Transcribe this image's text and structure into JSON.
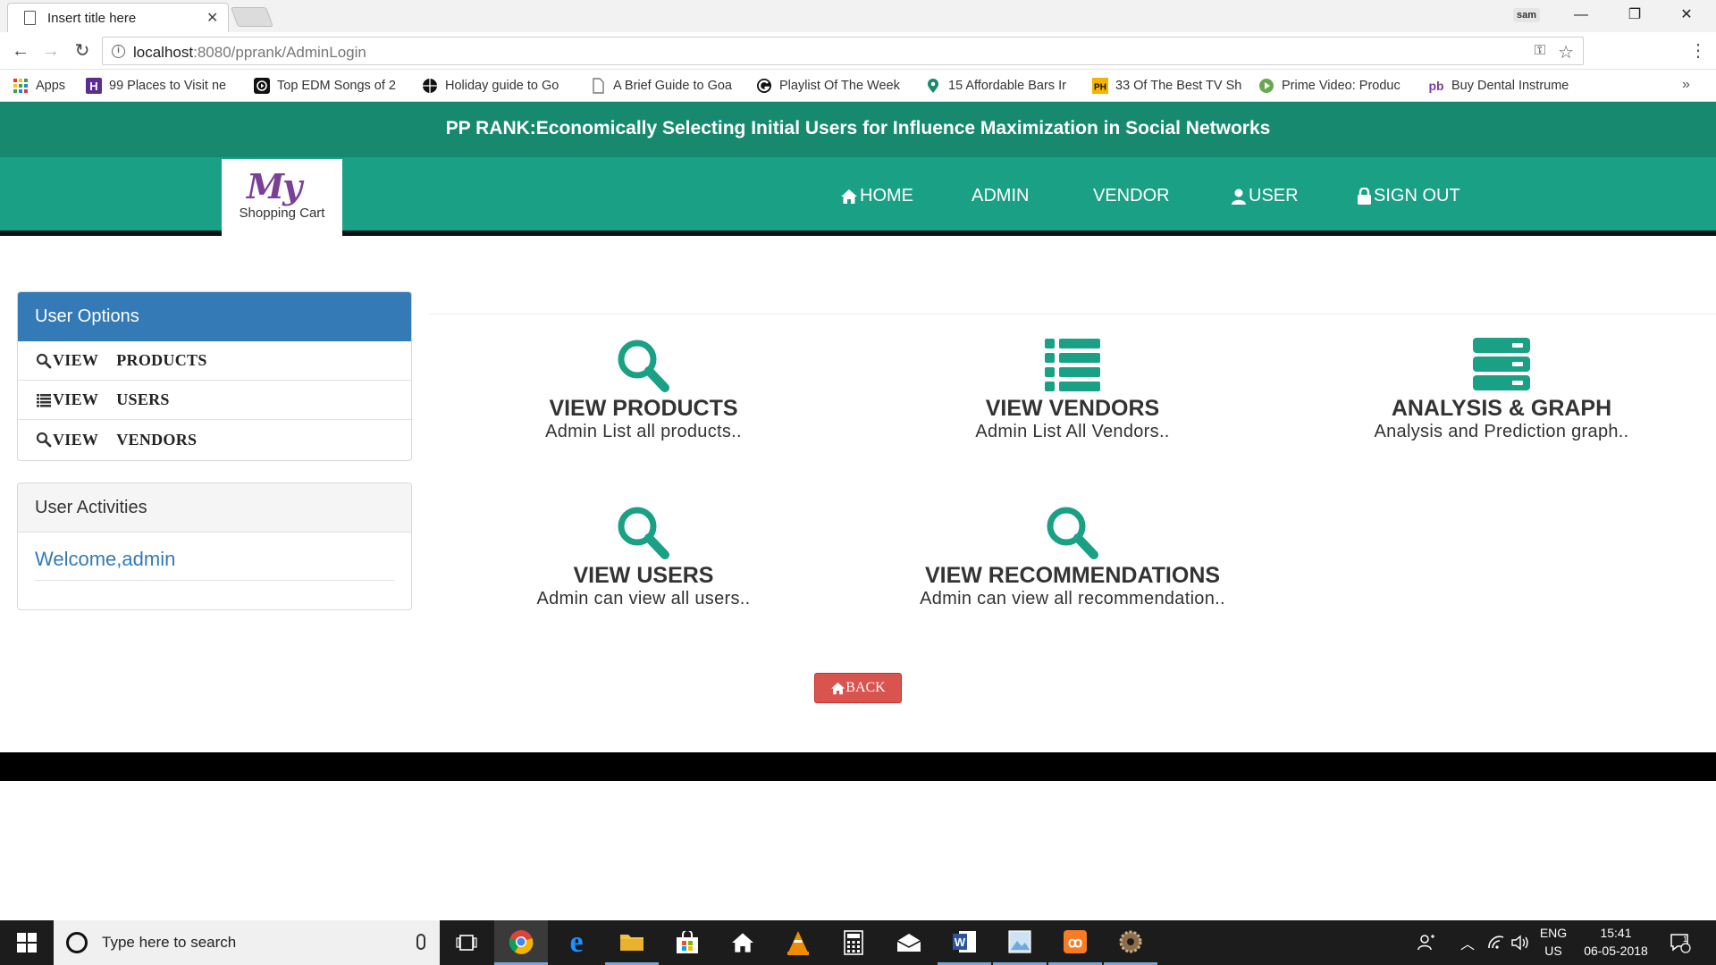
{
  "browser": {
    "tab_title": "Insert title here",
    "profile_name": "sam",
    "url_host": "localhost",
    "url_rest": ":8080/pprank/AdminLogin",
    "bookmarks": [
      {
        "label": "Apps",
        "icon": "apps-grid-icon",
        "color": "#e53935"
      },
      {
        "label": "99 Places to Visit ne",
        "icon": "h-bookmark-icon",
        "color": "#5c2d91"
      },
      {
        "label": "Top EDM Songs of 2",
        "icon": "play-circle-icon",
        "color": "#111111"
      },
      {
        "label": "Holiday guide to Go",
        "icon": "globe-icon",
        "color": "#111111"
      },
      {
        "label": "A Brief Guide to Goa",
        "icon": "page-icon",
        "color": "#777777"
      },
      {
        "label": "Playlist Of The Week",
        "icon": "g-logo-icon",
        "color": "#111111"
      },
      {
        "label": "15 Affordable Bars Ir",
        "icon": "map-pin-icon",
        "color": "#17896f"
      },
      {
        "label": "33 Of The Best TV Sh",
        "icon": "ph-icon",
        "color": "#f4b400"
      },
      {
        "label": "Prime Video: Produc",
        "icon": "prime-play-icon",
        "color": "#6aa84f"
      },
      {
        "label": "Buy Dental Instrume",
        "icon": "pb-icon",
        "color": "#7b3f98"
      }
    ]
  },
  "site": {
    "title": "PP RANK:Economically Selecting Initial Users for Influence Maximization in Social Networks",
    "logo_script": "My",
    "logo_text": "Shopping Cart",
    "nav": {
      "home": "HOME",
      "admin": "ADMIN",
      "vendor": "VENDOR",
      "user": "USER",
      "signout": "SIGN OUT"
    }
  },
  "sidebar": {
    "options_heading": "User Options",
    "options": [
      {
        "word1": "VIEW",
        "word2": "PRODUCTS",
        "icon": "search-icon"
      },
      {
        "word1": "VIEW",
        "word2": "USERS",
        "icon": "list-icon"
      },
      {
        "word1": "VIEW",
        "word2": "VENDORS",
        "icon": "search-icon"
      }
    ],
    "activities_heading": "User Activities",
    "welcome": "Welcome,admin"
  },
  "cards": [
    {
      "title": "VIEW PRODUCTS",
      "desc": "Admin List all products..",
      "icon": "search-icon"
    },
    {
      "title": "VIEW VENDORS",
      "desc": "Admin List All Vendors..",
      "icon": "list-icon"
    },
    {
      "title": "ANALYSIS & GRAPH",
      "desc": "Analysis and Prediction graph..",
      "icon": "server-icon"
    },
    {
      "title": "VIEW USERS",
      "desc": "Admin can view all users..",
      "icon": "search-icon"
    },
    {
      "title": "VIEW RECOMMENDATIONS",
      "desc": "Admin can view all recommendation..",
      "icon": "search-icon"
    }
  ],
  "back_label": "BACK",
  "colors": {
    "header": "#17896f",
    "nav": "#1aa085",
    "accent_icon": "#1aa085",
    "panel_blue": "#337ab7",
    "back_red": "#d9534f"
  },
  "taskbar": {
    "search_placeholder": "Type here to search",
    "lang_top": "ENG",
    "lang_bottom": "US",
    "time": "15:41",
    "date": "06-05-2018",
    "notification_count": "1"
  }
}
